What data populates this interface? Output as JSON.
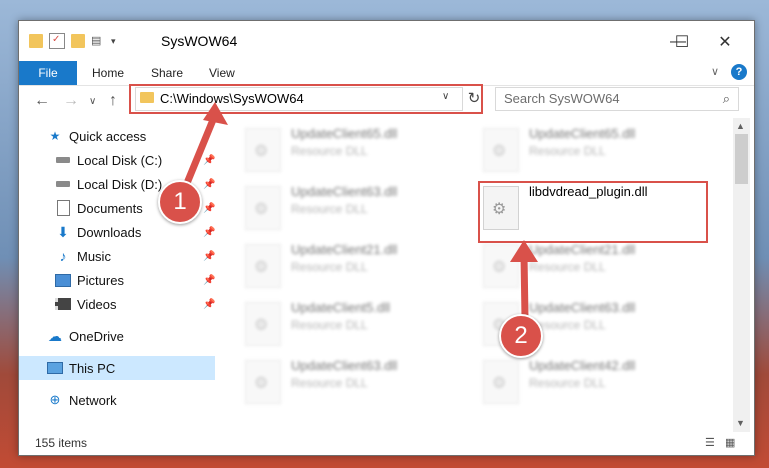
{
  "window": {
    "title": "SysWOW64",
    "minimize": "—",
    "maximize": "☐",
    "close": "✕"
  },
  "ribbon": {
    "tabs": [
      "File",
      "Home",
      "Share",
      "View"
    ],
    "help": "?"
  },
  "nav": {
    "address": "C:\\Windows\\SysWOW64",
    "search_placeholder": "Search SysWOW64"
  },
  "sidebar": {
    "items": [
      {
        "label": "Quick access",
        "icon": "star-icon"
      },
      {
        "label": "Local Disk (C:)",
        "icon": "drive-icon"
      },
      {
        "label": "Local Disk (D:)",
        "icon": "drive-icon"
      },
      {
        "label": "Documents",
        "icon": "documents-icon"
      },
      {
        "label": "Downloads",
        "icon": "download-icon"
      },
      {
        "label": "Music",
        "icon": "music-icon"
      },
      {
        "label": "Pictures",
        "icon": "pictures-icon"
      },
      {
        "label": "Videos",
        "icon": "videos-icon"
      },
      {
        "label": "OneDrive",
        "icon": "cloud-icon"
      },
      {
        "label": "This PC",
        "icon": "computer-icon"
      },
      {
        "label": "Network",
        "icon": "network-icon"
      }
    ]
  },
  "files": [
    {
      "name": "UpdateClient65.dll",
      "type": "Resource DLL"
    },
    {
      "name": "UpdateClient65.dll",
      "type": "Resource DLL"
    },
    {
      "name": "UpdateClient63.dll",
      "type": "Resource DLL"
    },
    {
      "name": "libdvdread_plugin.dll",
      "type": ""
    },
    {
      "name": "UpdateClient21.dll",
      "type": "Resource DLL"
    },
    {
      "name": "UpdateClient21.dll",
      "type": "Resource DLL"
    },
    {
      "name": "UpdateClient5.dll",
      "type": "Resource DLL"
    },
    {
      "name": "UpdateClient63.dll",
      "type": "Resource DLL"
    },
    {
      "name": "UpdateClient63.dll",
      "type": "Resource DLL"
    },
    {
      "name": "UpdateClient42.dll",
      "type": "Resource DLL"
    }
  ],
  "status": {
    "item_count": "155 items"
  },
  "annotations": {
    "marker1": "1",
    "marker2": "2",
    "color": "#d9514a"
  },
  "colors": {
    "accent": "#1979ca",
    "selected": "#cce8ff",
    "folder": "#f2c55c"
  }
}
